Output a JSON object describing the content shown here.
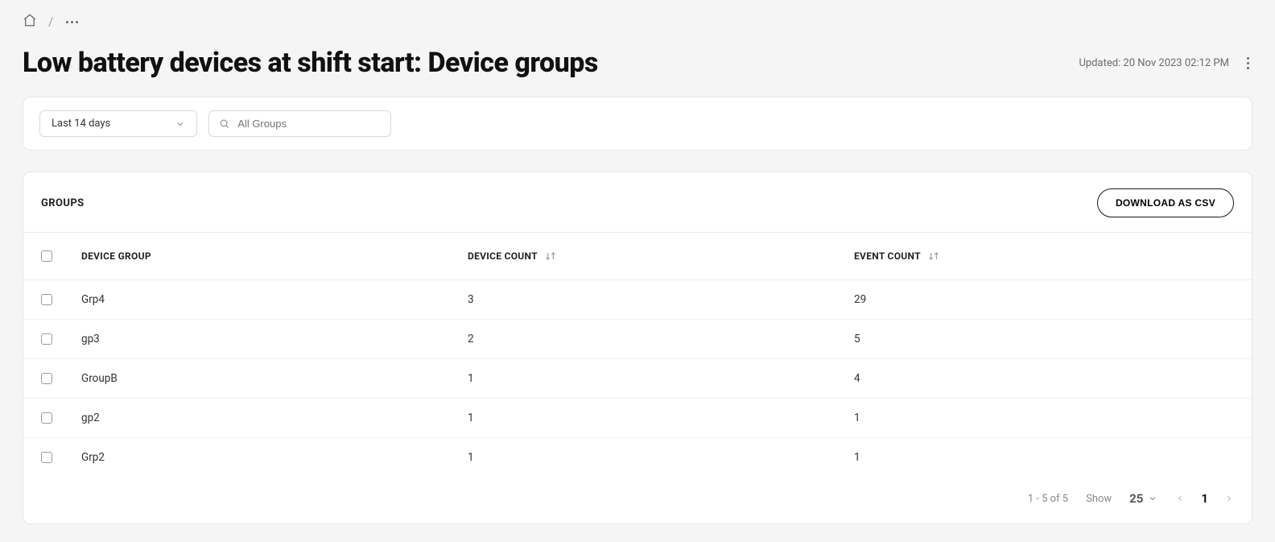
{
  "breadcrumb": {
    "separator": "/"
  },
  "header": {
    "title": "Low battery devices at shift start: Device groups",
    "updated_text": "Updated: 20 Nov 2023 02:12 PM"
  },
  "filters": {
    "date_range": "Last 14 days",
    "group_search_placeholder": "All Groups"
  },
  "table": {
    "section_label": "GROUPS",
    "download_label": "DOWNLOAD AS CSV",
    "columns": {
      "device_group": "DEVICE GROUP",
      "device_count": "DEVICE COUNT",
      "event_count": "EVENT COUNT"
    },
    "rows": [
      {
        "name": "Grp4",
        "device_count": "3",
        "event_count": "29"
      },
      {
        "name": "gp3",
        "device_count": "2",
        "event_count": "5"
      },
      {
        "name": "GroupB",
        "device_count": "1",
        "event_count": "4"
      },
      {
        "name": "gp2",
        "device_count": "1",
        "event_count": "1"
      },
      {
        "name": "Grp2",
        "device_count": "1",
        "event_count": "1"
      }
    ]
  },
  "pagination": {
    "range_text": "1 - 5 of 5",
    "show_label": "Show",
    "page_size": "25",
    "current_page": "1"
  }
}
